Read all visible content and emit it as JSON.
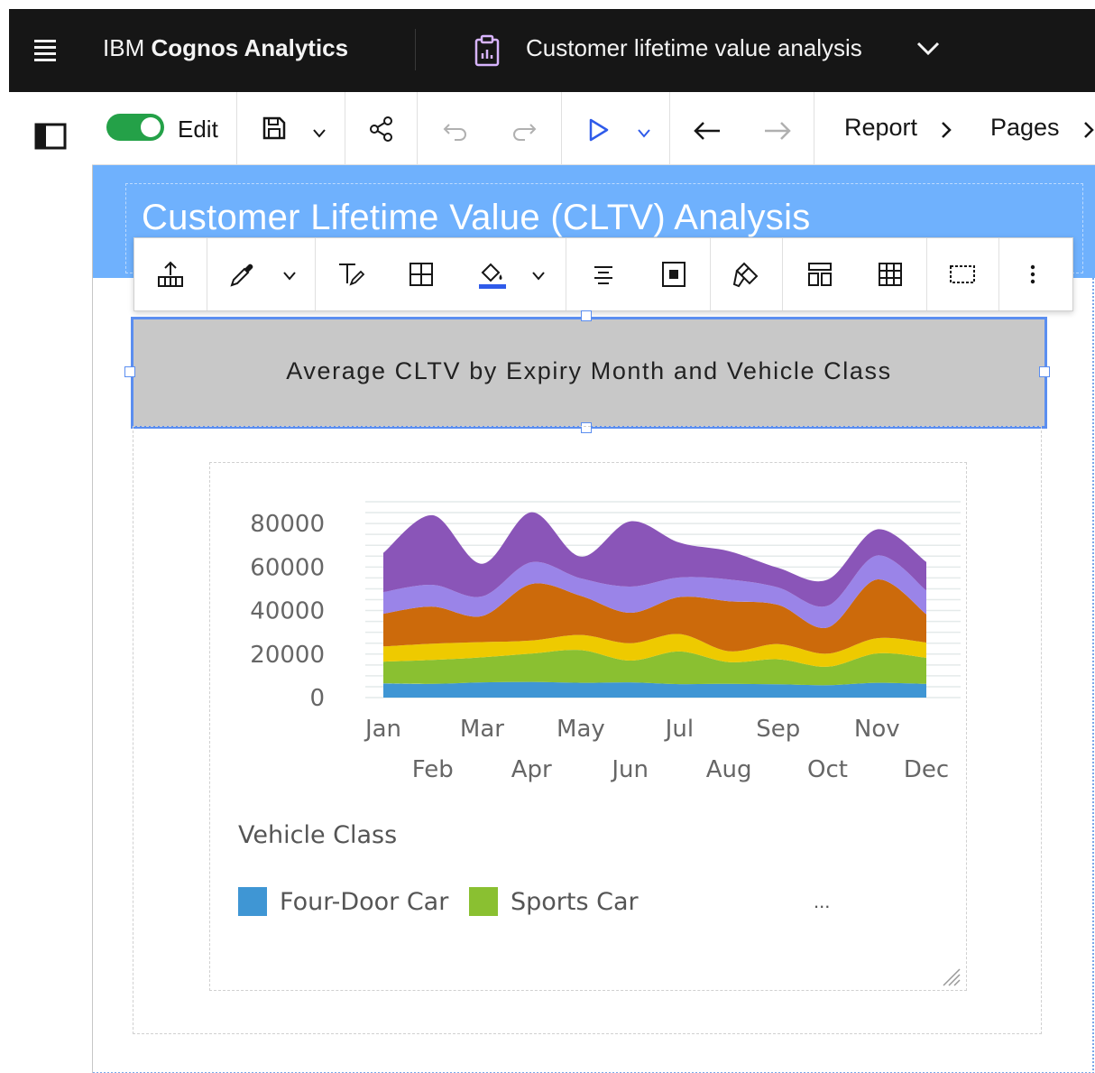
{
  "topbar": {
    "brand_prefix": "IBM",
    "brand_product": "Cognos Analytics",
    "report_title": "Customer lifetime value analysis"
  },
  "toolbar": {
    "edit_label": "Edit",
    "edit_on": true,
    "breadcrumb": [
      "Report",
      "Pages"
    ]
  },
  "canvas": {
    "report_heading": "Customer Lifetime Value (CLTV) Analysis",
    "selected_title": "Average CLTV by Expiry Month and Vehicle Class"
  },
  "colors": {
    "header_band": "#6fb1fd",
    "selection": "#5b8ef0",
    "toggle_on": "#24a148",
    "fill_underline": "#2f5bea"
  },
  "icons": {
    "format_toolbar": [
      "upload-data-icon",
      "eyedropper-icon",
      "text-style-icon",
      "table-icon",
      "fill-color-icon",
      "align-center-icon",
      "padding-icon",
      "style-brush-icon",
      "layout-icon",
      "grid-icon",
      "border-icon",
      "overflow-menu-icon"
    ]
  },
  "chart_data": {
    "type": "area",
    "stacked": true,
    "x": [
      "Jan",
      "Feb",
      "Mar",
      "Apr",
      "May",
      "Jun",
      "Jul",
      "Aug",
      "Sep",
      "Oct",
      "Nov",
      "Dec"
    ],
    "xticks_row1": [
      "Jan",
      "Mar",
      "May",
      "Jul",
      "Sep",
      "Nov"
    ],
    "xticks_row2": [
      "Feb",
      "Apr",
      "Jun",
      "Aug",
      "Oct",
      "Dec"
    ],
    "yticks": [
      "0",
      "20000",
      "40000",
      "60000",
      "80000"
    ],
    "ylim": [
      0,
      90000
    ],
    "grid": true,
    "series": [
      {
        "name": "Four-Door Car",
        "color": "#3f96d4",
        "values": [
          6500,
          6300,
          7000,
          7200,
          6800,
          7000,
          6200,
          6300,
          6100,
          5700,
          6800,
          6300
        ]
      },
      {
        "color": "#8ac031",
        "values": [
          10000,
          11000,
          11500,
          13000,
          15000,
          10000,
          15000,
          10000,
          11500,
          8500,
          13500,
          12000
        ]
      },
      {
        "color": "#eeca00",
        "values": [
          7000,
          7500,
          7000,
          6000,
          7000,
          8000,
          8000,
          5000,
          7000,
          6000,
          7000,
          7000
        ]
      },
      {
        "color": "#cc6a0b",
        "values": [
          15000,
          17000,
          12000,
          26000,
          18000,
          14000,
          17000,
          23000,
          18000,
          12000,
          27000,
          13000
        ]
      },
      {
        "color": "#9a84e8",
        "values": [
          10000,
          10000,
          9000,
          10000,
          8000,
          12000,
          9000,
          10000,
          8000,
          10000,
          11000,
          11000
        ]
      },
      {
        "color": "#8a55b8",
        "values": [
          18000,
          32000,
          15000,
          23000,
          10000,
          30000,
          16000,
          13000,
          9000,
          12000,
          12000,
          13000
        ]
      }
    ],
    "legend_title": "Vehicle Class",
    "legend": [
      {
        "name": "Four-Door Car",
        "color": "#3f96d4"
      },
      {
        "name": "Sports Car",
        "color": "#8ac031"
      }
    ],
    "legend_more": "..."
  }
}
